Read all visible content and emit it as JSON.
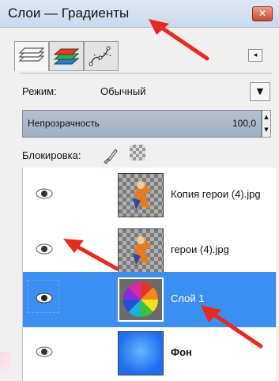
{
  "window": {
    "title": "Слои — Градиенты",
    "close_glyph": "✕",
    "tab_menu_glyph": "◂"
  },
  "tabs": [
    {
      "name": "layers-tab",
      "icon": "layers-icon"
    },
    {
      "name": "channels-tab",
      "icon": "channels-icon"
    },
    {
      "name": "paths-tab",
      "icon": "paths-icon"
    }
  ],
  "mode": {
    "label": "Режим:",
    "value": "Обычный",
    "dropdown_glyph": "▼"
  },
  "opacity": {
    "label": "Непрозрачность",
    "value": "100,0",
    "fraction": 1.0,
    "spin_up": "▲",
    "spin_down": "▼"
  },
  "lock": {
    "label": "Блокировка:"
  },
  "layers": [
    {
      "name": "Копия герои (4).jpg",
      "visible": true,
      "selected": false,
      "thumb": "checker-hero"
    },
    {
      "name": "герои (4).jpg",
      "visible": true,
      "selected": false,
      "thumb": "checker-hero"
    },
    {
      "name": "Слой 1",
      "visible": true,
      "selected": true,
      "thumb": "color-wheel"
    },
    {
      "name": "Фон",
      "visible": true,
      "selected": false,
      "thumb": "blue-gradient"
    }
  ],
  "colors": {
    "selection": "#3a8ff0",
    "annotation_arrow": "#e8291c",
    "titlebar": "#c9d9ec"
  }
}
